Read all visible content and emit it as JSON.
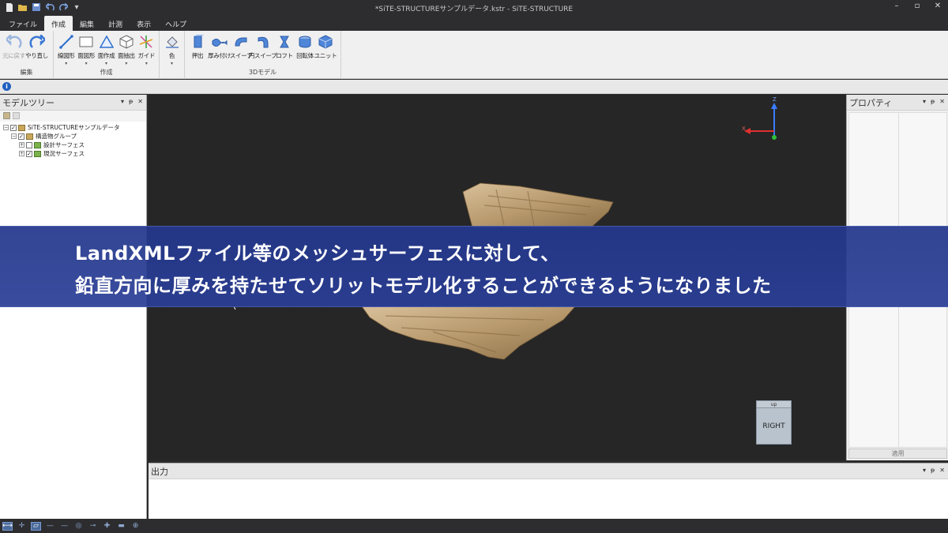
{
  "window": {
    "title": "*SiTE-STRUCTUREサンプルデータ.kstr - SiTE-STRUCTURE",
    "controls": [
      "–",
      "▫",
      "✕"
    ]
  },
  "tabs": [
    {
      "label": "ファイル"
    },
    {
      "label": "作成",
      "active": true
    },
    {
      "label": "編集"
    },
    {
      "label": "計測"
    },
    {
      "label": "表示"
    },
    {
      "label": "ヘルプ"
    }
  ],
  "ribbon": {
    "edit_group": {
      "label": "編集",
      "undo": "元に戻す",
      "redo": "やり直し"
    },
    "create_group": {
      "label": "作成",
      "line": "線図形",
      "plane": "面図形",
      "face": "面作成",
      "extract": "面抽出",
      "guide": "ガイド"
    },
    "color_group": {
      "label": "",
      "color": "色"
    },
    "model_group": {
      "label": "3Dモデル",
      "extrude": "押出",
      "thicken": "厚み付け",
      "sweep": "スイープ",
      "circle_sweep": "円スイープ",
      "loft": "ロフト",
      "revolve": "回転体",
      "unit": "ユニット"
    }
  },
  "model_tree": {
    "title": "モデルツリー",
    "items": [
      {
        "label": "SiTE-STRUCTUREサンプルデータ",
        "level": 0,
        "checked": true
      },
      {
        "label": "構造物グループ",
        "level": 1,
        "checked": true
      },
      {
        "label": "設計サーフェス",
        "level": 2,
        "checked": false
      },
      {
        "label": "現況サーフェス",
        "level": 2,
        "checked": true
      }
    ]
  },
  "viewport": {
    "view_cube_top": "up",
    "view_cube_face": "RIGHT",
    "axis_labels": {
      "z": "Z",
      "x": "X"
    }
  },
  "properties": {
    "title": "プロパティ",
    "apply_label": "適用"
  },
  "output": {
    "title": "出力"
  },
  "caption": {
    "line1": "LandXMLファイル等のメッシュサーフェスに対して、",
    "line2": "鉛直方向に厚みを持たせてソリットモデル化することができるようになりました"
  },
  "colors": {
    "caption_bg": "#2a3c96",
    "viewport_bg": "#262626",
    "mesh": "#b89a6e",
    "chrome_dark": "#2d2d30",
    "ribbon_bg": "#f0f0f0"
  }
}
